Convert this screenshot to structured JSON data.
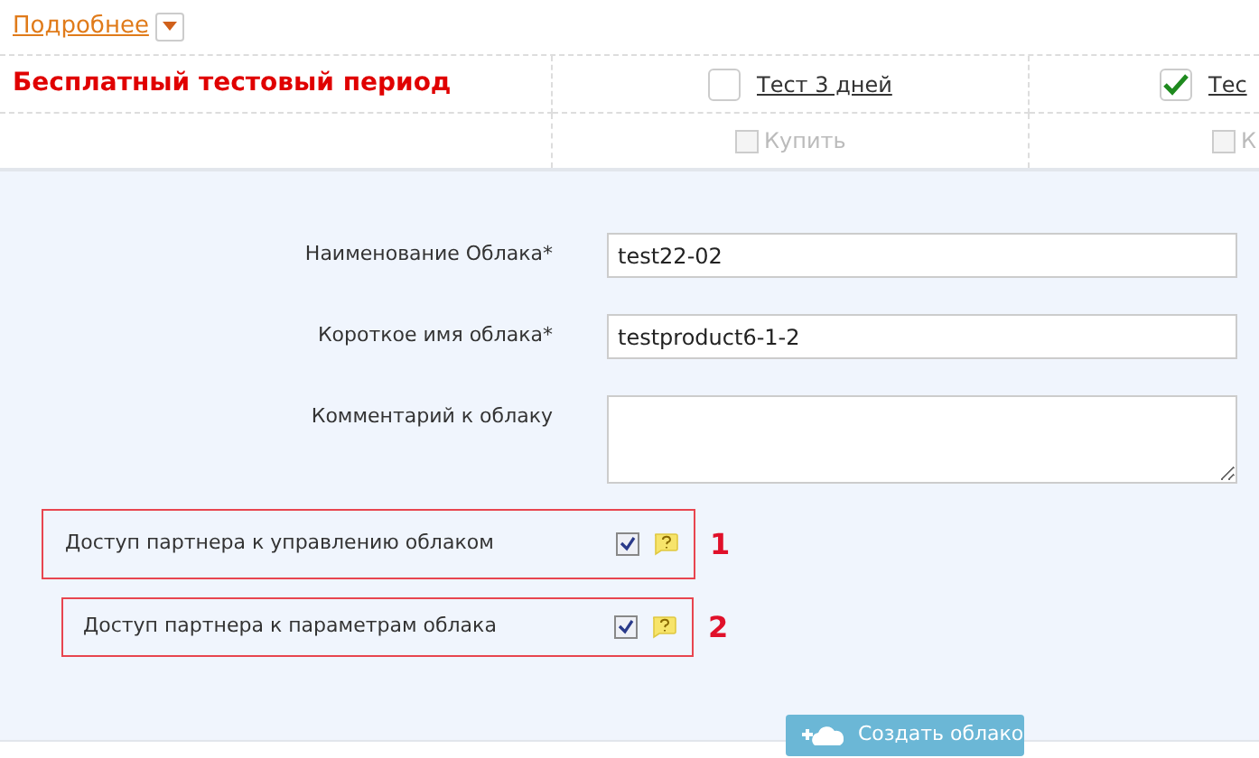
{
  "details_link": {
    "label": "Подробнее"
  },
  "trial": {
    "title": "Бесплатный тестовый период",
    "plans": [
      {
        "label": "Тест 3 дней",
        "checked": false,
        "buy_label": "Купить",
        "buy_checked": false,
        "buy_disabled": true
      },
      {
        "label": "Тес",
        "checked": true,
        "buy_label": "К",
        "buy_checked": false,
        "buy_disabled": true
      }
    ]
  },
  "form": {
    "fields": [
      {
        "kind": "input",
        "label": "Наименование Облака*",
        "value": "test22-02"
      },
      {
        "kind": "input",
        "label": "Короткое имя облака*",
        "value": "testproduct6-1-2"
      },
      {
        "kind": "textarea",
        "label": "Комментарий к облаку"
      }
    ],
    "options": [
      {
        "label": "Доступ партнера к управлению облаком",
        "checked": true,
        "annotation": "1"
      },
      {
        "label": "Доступ партнера к параметрам облака",
        "checked": true,
        "annotation": "2"
      }
    ],
    "submit": {
      "label": "Создать облако"
    }
  }
}
